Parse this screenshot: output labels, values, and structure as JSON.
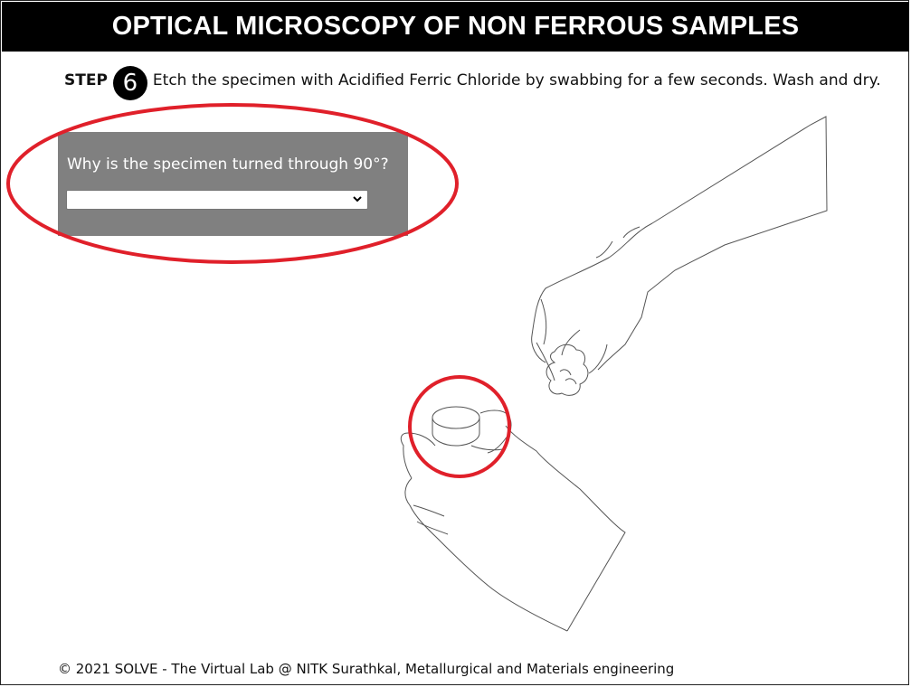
{
  "header": {
    "title": "OPTICAL MICROSCOPY OF NON FERROUS SAMPLES"
  },
  "step": {
    "label": "STEP",
    "number": "6",
    "instruction": "Etch the specimen with Acidified Ferric Chloride by swabbing for a few seconds. Wash and dry."
  },
  "question": {
    "text": "Why is the specimen turned through 90°?",
    "selected_value": ""
  },
  "annotations": {
    "highlight_color": "#e0202a"
  },
  "footer": {
    "text": "© 2021 SOLVE - The Virtual Lab @ NITK Surathkal, Metallurgical and Materials engineering"
  }
}
